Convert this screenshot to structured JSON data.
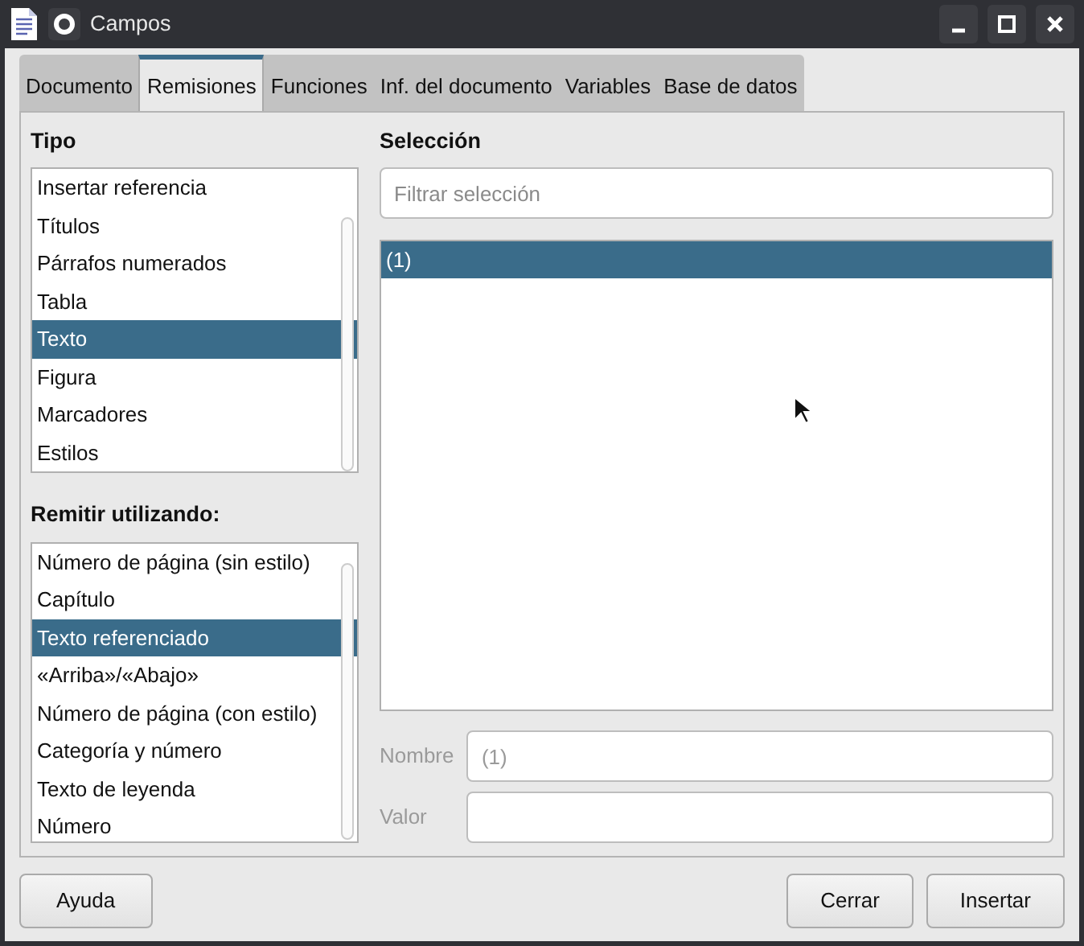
{
  "window": {
    "title": "Campos"
  },
  "tabs": [
    {
      "label": "Documento",
      "selected": false
    },
    {
      "label": "Remisiones",
      "selected": true
    },
    {
      "label": "Funciones",
      "selected": false
    },
    {
      "label": "Inf. del documento",
      "selected": false
    },
    {
      "label": "Variables",
      "selected": false
    },
    {
      "label": "Base de datos",
      "selected": false
    }
  ],
  "tipo": {
    "heading": "Tipo",
    "items": [
      {
        "label": "Insertar referencia",
        "selected": false
      },
      {
        "label": "Títulos",
        "selected": false
      },
      {
        "label": "Párrafos numerados",
        "selected": false
      },
      {
        "label": "Tabla",
        "selected": false
      },
      {
        "label": "Texto",
        "selected": true
      },
      {
        "label": "Figura",
        "selected": false
      },
      {
        "label": "Marcadores",
        "selected": false
      },
      {
        "label": "Estilos",
        "selected": false
      }
    ]
  },
  "remitir": {
    "heading": "Remitir utilizando:",
    "items": [
      {
        "label": "Número de página (sin estilo)",
        "selected": false
      },
      {
        "label": "Capítulo",
        "selected": false
      },
      {
        "label": "Texto referenciado",
        "selected": true
      },
      {
        "label": "«Arriba»/«Abajo»",
        "selected": false
      },
      {
        "label": "Número de página (con estilo)",
        "selected": false
      },
      {
        "label": "Categoría y número",
        "selected": false
      },
      {
        "label": "Texto de leyenda",
        "selected": false
      },
      {
        "label": "Número",
        "selected": false
      }
    ]
  },
  "seleccion": {
    "heading": "Selección",
    "filter": {
      "placeholder": "Filtrar selección"
    },
    "items": [
      {
        "label": "(1)",
        "selected": true
      }
    ]
  },
  "fields": [
    {
      "label": "Nombre",
      "value": "(1)",
      "disabled": true
    },
    {
      "label": "Valor",
      "disabled": true
    }
  ],
  "buttons": [
    {
      "label": "Ayuda",
      "kind": "left"
    },
    {
      "label": "Cerrar",
      "kind": "right"
    },
    {
      "label": "Insertar",
      "kind": "right"
    }
  ]
}
